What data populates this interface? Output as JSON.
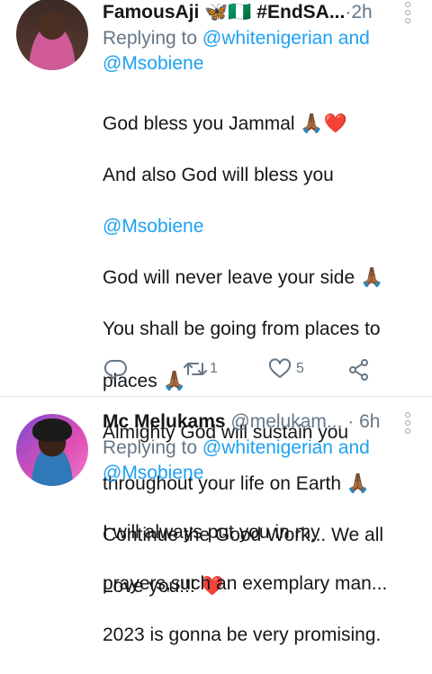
{
  "tweets": [
    {
      "name": "FamousAji 🦋🇳🇬 #EndSA...",
      "dot": " · ",
      "time": "2h",
      "replying_prefix": "Replying to ",
      "replying_link1": "@whitenigerian and",
      "replying_link2": "@Msobiene",
      "body_lines": [
        "God bless you Jammal 🙏🏾❤️",
        "And also God will bless you",
        "@Msobiene",
        "God will never leave your side 🙏🏾",
        "You shall be going from places to",
        "places 🙏🏾",
        "Almighty God will sustain you",
        "throughout your life on Earth 🙏🏾",
        "Continue the Good Work... We all",
        "Love you!!! ❤️"
      ],
      "retweets": "1",
      "likes": "5"
    },
    {
      "name": "Mc Melukams",
      "handle": " @melukam... ",
      "dot": "· ",
      "time": "6h",
      "replying_prefix": "Replying to ",
      "replying_link1": "@whitenigerian and",
      "replying_link2": "@Msobiene",
      "body_lines": [
        "I will always put you in my",
        "prayers,such an exemplary man...",
        "2023 is gonna be very promising."
      ]
    }
  ],
  "icons": {
    "reply": "reply-icon",
    "retweet": "retweet-icon",
    "like": "heart-icon",
    "share": "share-icon",
    "more": "more-vertical-icon"
  },
  "colors": {
    "link": "#1da1f2",
    "muted": "#657786",
    "text": "#14171a",
    "divider": "#e1e8ed"
  }
}
